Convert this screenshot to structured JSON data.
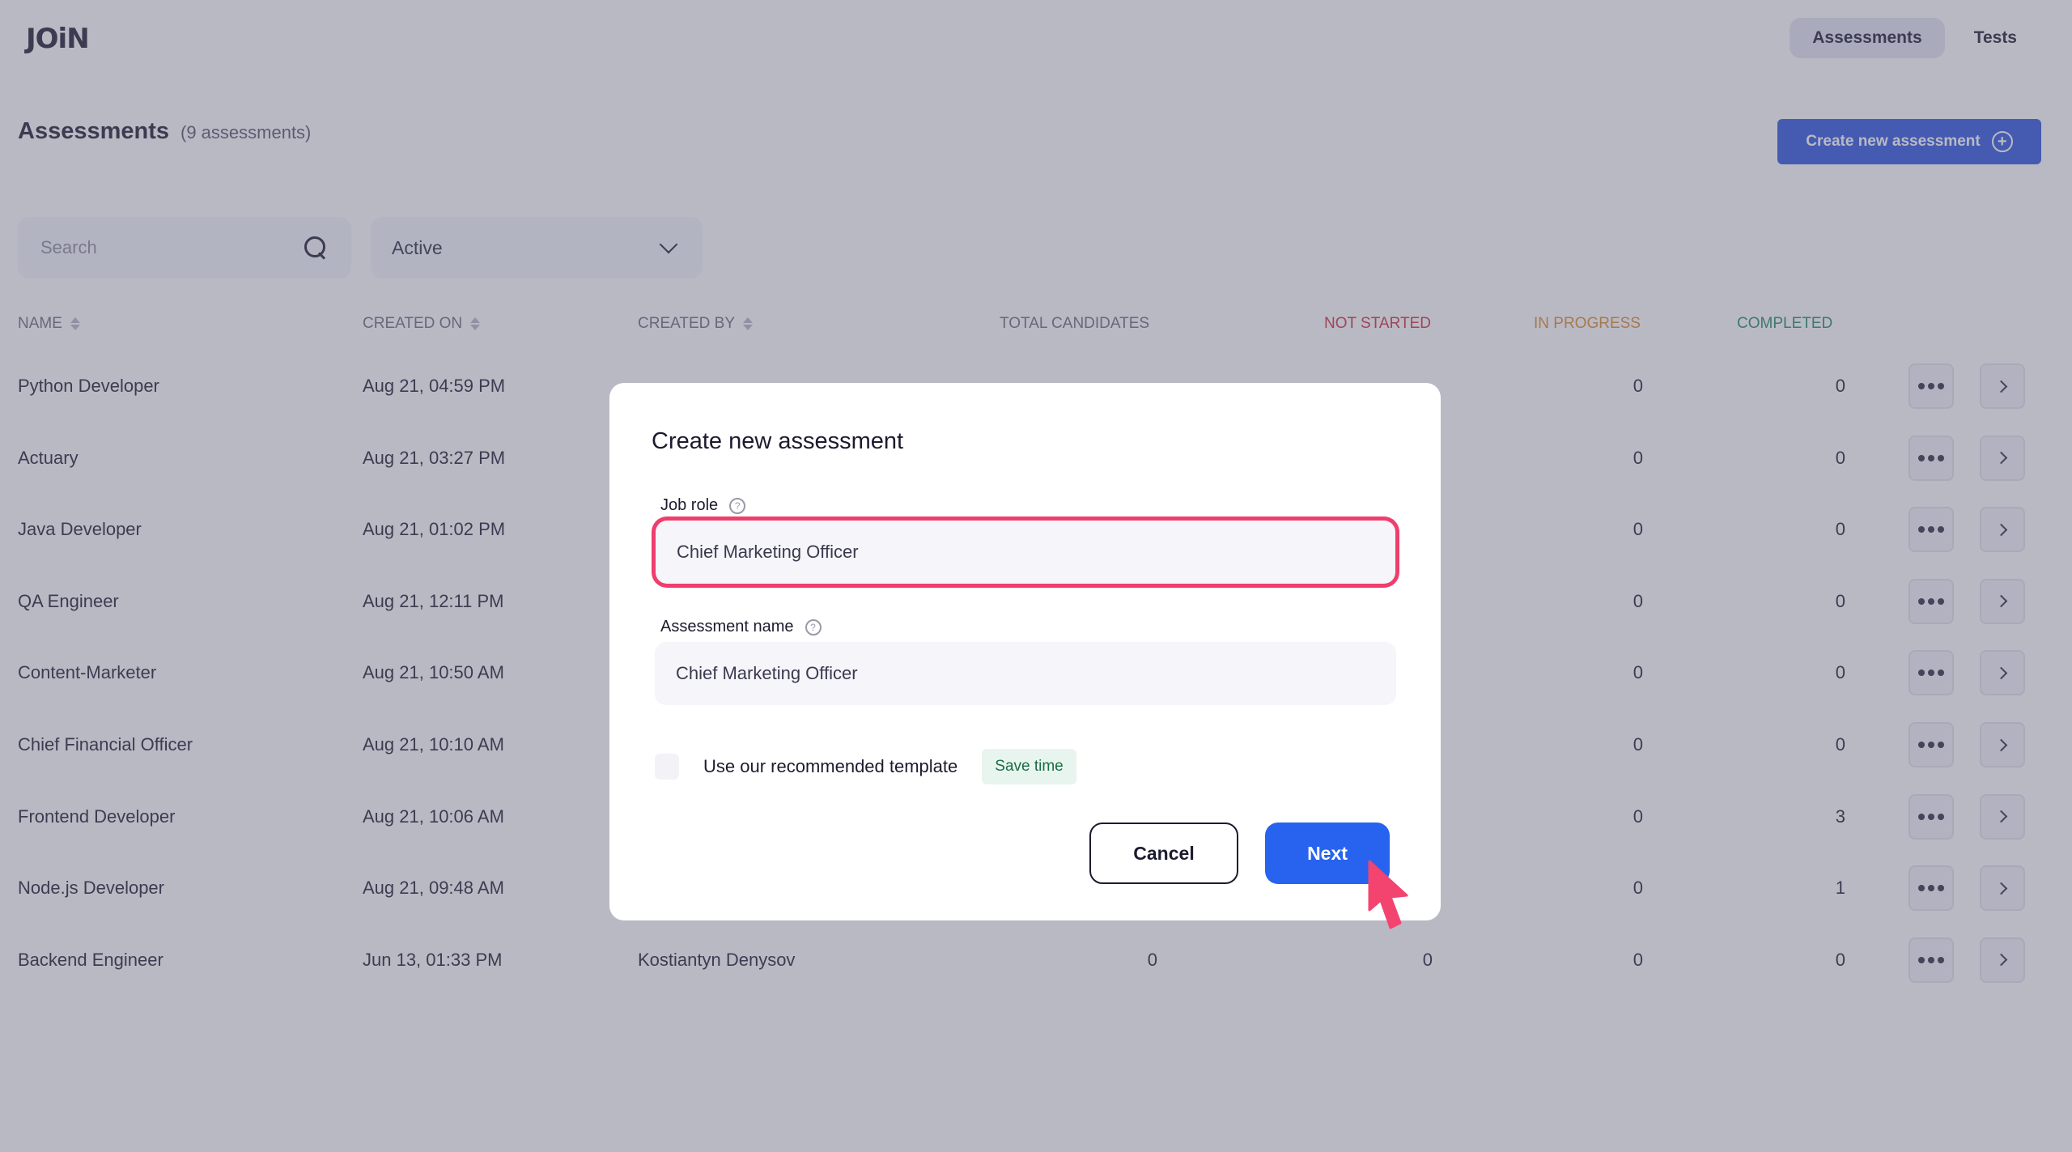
{
  "header": {
    "logo": "JOiN",
    "tabs": [
      {
        "label": "Assessments",
        "active": true
      },
      {
        "label": "Tests",
        "active": false
      }
    ]
  },
  "page": {
    "title": "Assessments",
    "count_label": "(9 assessments)",
    "create_button": "Create new assessment",
    "create_icon": "plus-circle-icon"
  },
  "filters": {
    "search_placeholder": "Search",
    "search_value": "",
    "status_selected": "Active"
  },
  "table": {
    "columns": {
      "name": "NAME",
      "created_on": "CREATED ON",
      "created_by": "CREATED BY",
      "total_candidates": "TOTAL CANDIDATES",
      "not_started": "NOT STARTED",
      "in_progress": "IN PROGRESS",
      "completed": "COMPLETED"
    },
    "colors": {
      "not_started": "#d12c3a",
      "in_progress": "#dd8b28",
      "completed": "#1f8a60"
    },
    "rows": [
      {
        "name": "Python Developer",
        "created_on": "Aug 21, 04:59 PM",
        "created_by": "",
        "total": "",
        "not_started": "",
        "in_progress": "0",
        "completed": "0"
      },
      {
        "name": "Actuary",
        "created_on": "Aug 21, 03:27 PM",
        "created_by": "",
        "total": "",
        "not_started": "",
        "in_progress": "0",
        "completed": "0"
      },
      {
        "name": "Java Developer",
        "created_on": "Aug 21, 01:02 PM",
        "created_by": "",
        "total": "",
        "not_started": "",
        "in_progress": "0",
        "completed": "0"
      },
      {
        "name": "QA Engineer",
        "created_on": "Aug 21, 12:11 PM",
        "created_by": "",
        "total": "",
        "not_started": "",
        "in_progress": "0",
        "completed": "0"
      },
      {
        "name": "Content-Marketer",
        "created_on": "Aug 21, 10:50 AM",
        "created_by": "",
        "total": "",
        "not_started": "",
        "in_progress": "0",
        "completed": "0"
      },
      {
        "name": "Chief Financial Officer",
        "created_on": "Aug 21, 10:10 AM",
        "created_by": "",
        "total": "",
        "not_started": "",
        "in_progress": "0",
        "completed": "0"
      },
      {
        "name": "Frontend Developer",
        "created_on": "Aug 21, 10:06 AM",
        "created_by": "",
        "total": "",
        "not_started": "",
        "in_progress": "0",
        "completed": "3"
      },
      {
        "name": "Node.js Developer",
        "created_on": "Aug 21, 09:48 AM",
        "created_by": "",
        "total": "",
        "not_started": "",
        "in_progress": "0",
        "completed": "1"
      },
      {
        "name": "Backend Engineer",
        "created_on": "Jun 13, 01:33 PM",
        "created_by": "Kostiantyn Denysov",
        "total": "0",
        "not_started": "0",
        "in_progress": "0",
        "completed": "0"
      }
    ]
  },
  "modal": {
    "title": "Create new assessment",
    "job_role_label": "Job role",
    "job_role_value": "Chief Marketing Officer",
    "assessment_name_label": "Assessment name",
    "assessment_name_value": "Chief Marketing Officer",
    "template_checkbox_label": "Use our recommended template",
    "template_checked": false,
    "badge": "Save time",
    "cancel_label": "Cancel",
    "next_label": "Next",
    "highlight_color": "#ef3e6d",
    "primary_color": "#2863f0"
  }
}
